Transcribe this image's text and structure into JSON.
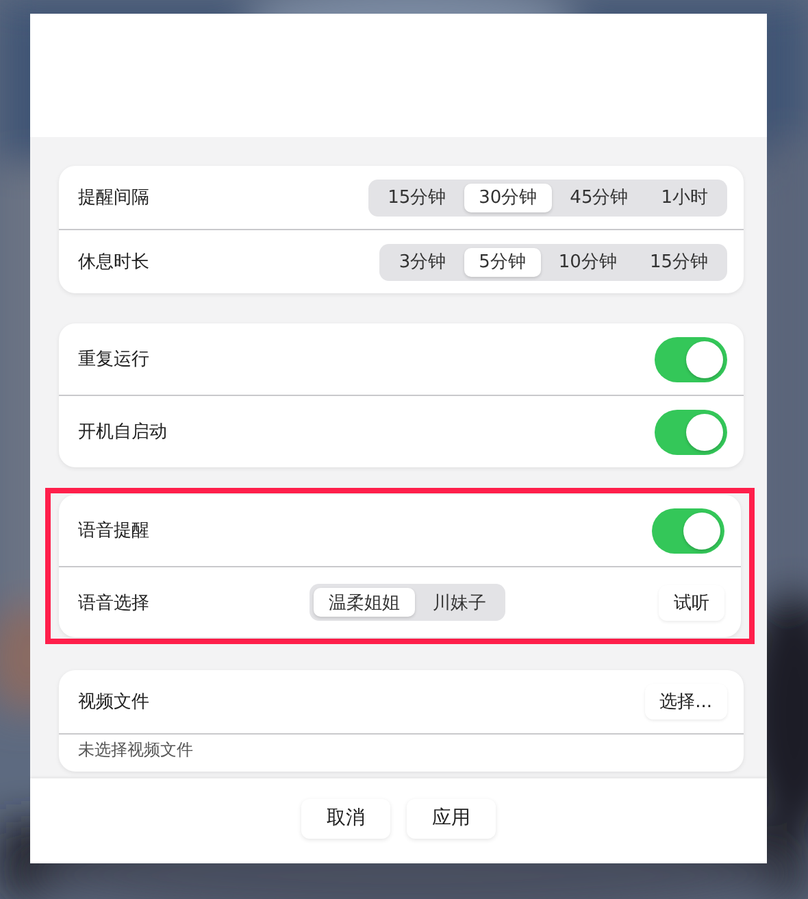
{
  "sections": [
    {
      "highlighted": false,
      "rows": [
        {
          "kind": "segmented",
          "label": "提醒间隔",
          "options": [
            {
              "label": "15分钟",
              "selected": false
            },
            {
              "label": "30分钟",
              "selected": true
            },
            {
              "label": "45分钟",
              "selected": false
            },
            {
              "label": "1小时",
              "selected": false
            }
          ]
        },
        {
          "kind": "segmented",
          "label": "休息时长",
          "options": [
            {
              "label": "3分钟",
              "selected": false
            },
            {
              "label": "5分钟",
              "selected": true
            },
            {
              "label": "10分钟",
              "selected": false
            },
            {
              "label": "15分钟",
              "selected": false
            }
          ]
        }
      ]
    },
    {
      "highlighted": false,
      "rows": [
        {
          "kind": "toggle",
          "label": "重复运行",
          "on": true
        },
        {
          "kind": "toggle",
          "label": "开机自启动",
          "on": true
        }
      ]
    },
    {
      "highlighted": true,
      "rows": [
        {
          "kind": "toggle",
          "label": "语音提醒",
          "on": true
        },
        {
          "kind": "voice",
          "label": "语音选择",
          "options": [
            {
              "label": "温柔姐姐",
              "selected": true
            },
            {
              "label": "川妹子",
              "selected": false
            }
          ],
          "button": "试听"
        }
      ]
    },
    {
      "highlighted": false,
      "rows": [
        {
          "kind": "file",
          "label": "视频文件",
          "button": "选择...",
          "note": "未选择视频文件"
        }
      ]
    }
  ],
  "footer": {
    "buttons": [
      "取消",
      "应用"
    ]
  }
}
